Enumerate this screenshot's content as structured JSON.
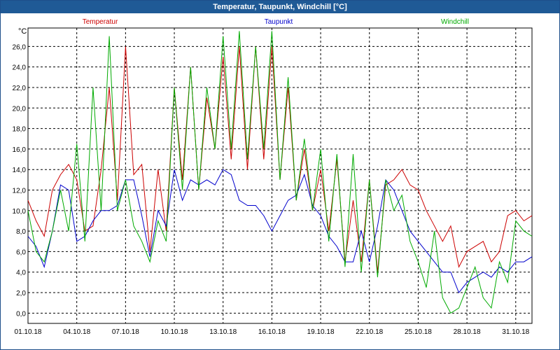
{
  "window": {
    "title": "Temperatur, Taupunkt, Windchill [°C]"
  },
  "colors": {
    "temperature": "#cc0000",
    "dewpoint": "#0000cc",
    "windchill": "#00aa00",
    "grid": "#000000",
    "titlebar": "#1f5a96"
  },
  "chart_data": {
    "type": "line",
    "title": "Temperatur, Taupunkt, Windchill [°C]",
    "ylabel": "°C",
    "ylim": [
      -1.0,
      27.8
    ],
    "yticks": [
      0.0,
      2.0,
      4.0,
      6.0,
      8.0,
      10.0,
      12.0,
      14.0,
      16.0,
      18.0,
      20.0,
      22.0,
      24.0,
      26.0
    ],
    "ytick_labels": [
      "0,0",
      "2,0",
      "4,0",
      "6,0",
      "8,0",
      "10,0",
      "12,0",
      "14,0",
      "16,0",
      "18,0",
      "20,0",
      "22,0",
      "24,0",
      "26,0"
    ],
    "xlim": [
      0,
      31
    ],
    "xticks": [
      0,
      3,
      6,
      9,
      12,
      15,
      18,
      21,
      24,
      27,
      30
    ],
    "xtick_labels": [
      "01.10.18",
      "04.10.18",
      "07.10.18",
      "10.10.18",
      "13.10.18",
      "16.10.18",
      "19.10.18",
      "22.10.18",
      "25.10.18",
      "28.10.18",
      "31.10.18"
    ],
    "grid": true,
    "legend": {
      "position": "top",
      "entries": [
        "Temperatur",
        "Taupunkt",
        "Windchill"
      ]
    },
    "x": [
      0,
      0.5,
      1,
      1.5,
      2,
      2.5,
      3,
      3.5,
      4,
      4.5,
      5,
      5.5,
      6,
      6.5,
      7,
      7.5,
      8,
      8.5,
      9,
      9.5,
      10,
      10.5,
      11,
      11.5,
      12,
      12.5,
      13,
      13.5,
      14,
      14.5,
      15,
      15.5,
      16,
      16.5,
      17,
      17.5,
      18,
      18.5,
      19,
      19.5,
      20,
      20.5,
      21,
      21.5,
      22,
      22.5,
      23,
      23.5,
      24,
      24.5,
      25,
      25.5,
      26,
      26.5,
      27,
      27.5,
      28,
      28.5,
      29,
      29.5,
      30,
      30.5,
      31
    ],
    "series": [
      {
        "name": "Temperatur",
        "values": [
          11.0,
          9.0,
          7.5,
          12.0,
          13.5,
          14.5,
          13.0,
          8.0,
          8.5,
          14.0,
          22.0,
          11.0,
          26.0,
          13.5,
          14.5,
          6.0,
          14.0,
          8.0,
          22.0,
          13.0,
          24.0,
          12.0,
          21.0,
          16.0,
          25.0,
          15.0,
          26.0,
          14.0,
          26.0,
          15.0,
          26.0,
          13.0,
          22.0,
          11.0,
          16.0,
          10.0,
          14.0,
          8.0,
          15.0,
          5.0,
          11.0,
          5.0,
          13.0,
          4.0,
          12.5,
          13.0,
          14.0,
          12.5,
          12.0,
          10.0,
          8.5,
          7.0,
          8.5,
          4.5,
          6.0,
          6.5,
          7.0,
          5.0,
          6.0,
          9.5,
          10.0,
          9.0,
          9.5
        ]
      },
      {
        "name": "Taupunkt",
        "values": [
          7.5,
          6.5,
          4.5,
          8.0,
          12.5,
          12.0,
          7.0,
          7.5,
          9.0,
          10.0,
          10.0,
          10.5,
          13.0,
          13.0,
          9.5,
          5.5,
          10.0,
          8.5,
          14.0,
          11.0,
          13.0,
          12.5,
          13.0,
          12.5,
          14.0,
          13.5,
          11.0,
          10.5,
          10.5,
          9.5,
          8.0,
          9.5,
          11.0,
          11.5,
          13.5,
          10.5,
          9.5,
          7.5,
          6.5,
          5.0,
          5.0,
          8.0,
          5.0,
          8.5,
          13.0,
          12.0,
          10.0,
          8.0,
          7.0,
          6.0,
          5.0,
          4.0,
          4.0,
          2.0,
          3.0,
          3.5,
          4.0,
          3.5,
          4.5,
          4.0,
          5.0,
          5.0,
          5.5
        ]
      },
      {
        "name": "Windchill",
        "values": [
          10.0,
          6.0,
          5.0,
          8.0,
          12.0,
          8.0,
          16.5,
          7.0,
          22.0,
          10.0,
          27.0,
          10.0,
          13.0,
          8.5,
          7.0,
          5.0,
          9.0,
          7.0,
          22.0,
          12.0,
          24.0,
          12.0,
          22.0,
          16.0,
          27.0,
          16.0,
          27.5,
          15.0,
          26.0,
          16.0,
          27.5,
          13.0,
          23.0,
          11.0,
          17.0,
          10.0,
          16.0,
          7.0,
          15.5,
          4.5,
          15.5,
          4.0,
          13.0,
          3.5,
          13.0,
          10.0,
          11.5,
          7.0,
          5.0,
          2.5,
          8.0,
          1.5,
          0.0,
          0.5,
          2.5,
          4.5,
          1.5,
          0.5,
          5.0,
          3.0,
          9.0,
          8.0,
          7.5
        ]
      }
    ]
  }
}
